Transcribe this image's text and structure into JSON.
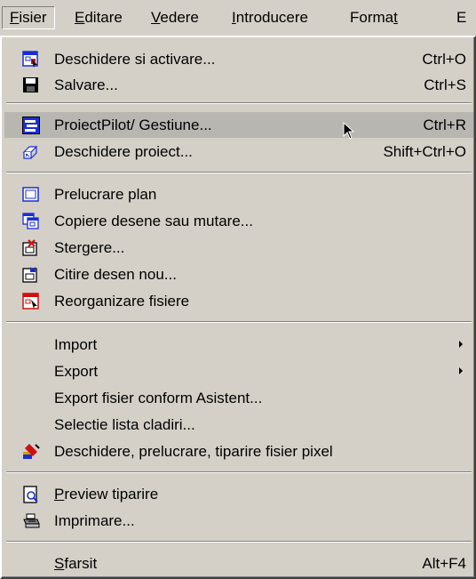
{
  "menubar": {
    "items": [
      {
        "label": "Fisier",
        "u": "F"
      },
      {
        "label": "Editare",
        "u": "E"
      },
      {
        "label": "Vedere",
        "u": "V"
      },
      {
        "label": "Introducere",
        "u": "I"
      },
      {
        "label": "Format",
        "u": "t"
      },
      {
        "label": "E"
      }
    ]
  },
  "menu": {
    "items": [
      {
        "label": "Deschidere si activare...",
        "shortcut": "Ctrl+O",
        "icon": "open-activate-icon"
      },
      {
        "label": "Salvare...",
        "shortcut": "Ctrl+S",
        "icon": "floppy-disk-icon"
      },
      {
        "label": "ProiectPilot/ Gestiune...",
        "shortcut": "Ctrl+R",
        "icon": "project-pilot-icon",
        "highlighted": true
      },
      {
        "label": "Deschidere proiect...",
        "shortcut": "Shift+Ctrl+O",
        "icon": "open-project-icon"
      },
      {
        "label": "Prelucrare plan",
        "icon": "edit-plan-icon"
      },
      {
        "label": "Copiere desene sau mutare...",
        "icon": "copy-drawings-icon"
      },
      {
        "label": "Stergere...",
        "icon": "delete-drawing-icon"
      },
      {
        "label": "Citire desen nou...",
        "icon": "read-drawing-icon"
      },
      {
        "label": "Reorganizare fisiere",
        "icon": "reorganize-files-icon"
      },
      {
        "label": "Import",
        "submenu": true
      },
      {
        "label": "Export",
        "submenu": true
      },
      {
        "label": "Export fisier conform Asistent..."
      },
      {
        "label": "Selectie lista cladiri..."
      },
      {
        "label": "Deschidere, prelucrare, tiparire fisier pixel",
        "icon": "pixel-file-icon"
      },
      {
        "label": "Preview tiparire",
        "icon": "print-preview-icon",
        "u": "P"
      },
      {
        "label": "Imprimare...",
        "icon": "printer-icon"
      },
      {
        "label": "Sfarsit",
        "shortcut": "Alt+F4",
        "u": "S"
      }
    ]
  },
  "colors": {
    "menu_bg": "#d4d0c8",
    "highlight_bg": "#b8b6b1",
    "icon_blue": "#1a2fd0",
    "icon_red": "#d01010"
  }
}
